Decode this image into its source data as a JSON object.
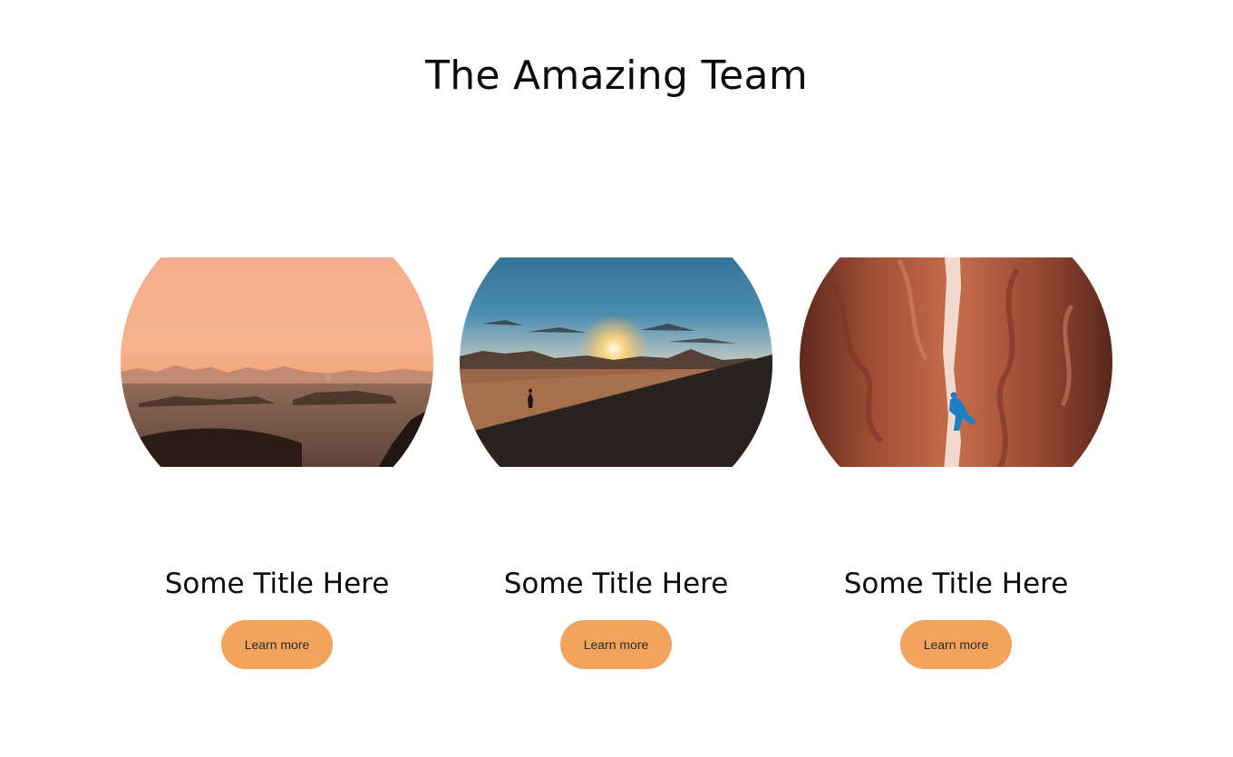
{
  "page": {
    "title": "The Amazing Team"
  },
  "colors": {
    "button_bg": "#F2A35E",
    "background": "#FFFFFF",
    "text": "#0B0B0B"
  },
  "cards": [
    {
      "title": "Some Title Here",
      "button_label": "Learn more",
      "image": "desert-sunset-photo"
    },
    {
      "title": "Some Title Here",
      "button_label": "Learn more",
      "image": "dune-hiker-sunrise-photo"
    },
    {
      "title": "Some Title Here",
      "button_label": "Learn more",
      "image": "canyon-climber-photo"
    }
  ]
}
